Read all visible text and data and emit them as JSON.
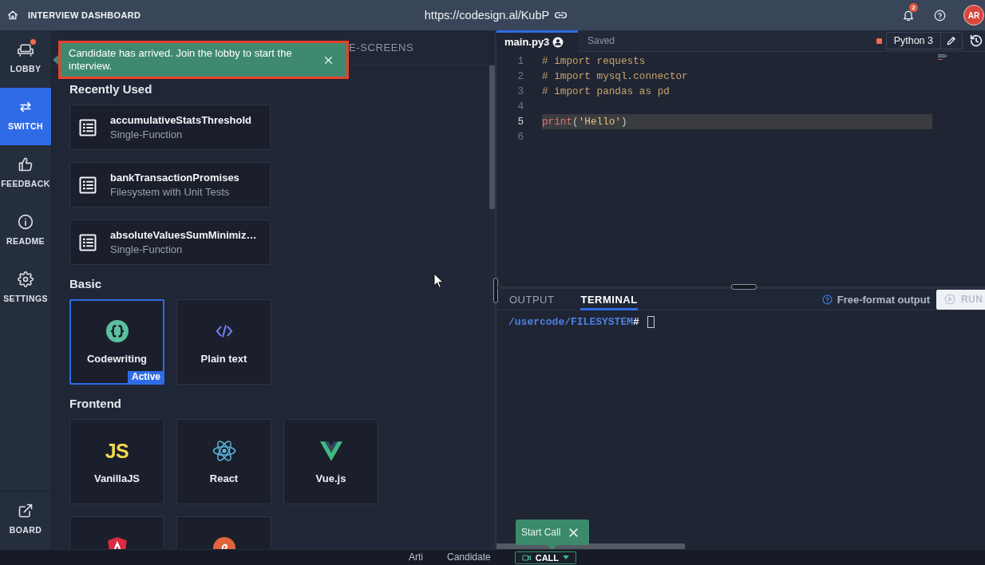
{
  "topbar": {
    "title": "INTERVIEW DASHBOARD",
    "url": "https://codesign.al/KubP",
    "notification_count": "2",
    "avatar_initials": "AR"
  },
  "sidebar": {
    "items": [
      {
        "kind": "lobby",
        "label": "LOBBY",
        "selected": false,
        "alert": true
      },
      {
        "kind": "switch",
        "label": "SWITCH",
        "selected": true,
        "alert": false
      },
      {
        "kind": "feedback",
        "label": "FEEDBACK",
        "selected": false,
        "alert": false
      },
      {
        "kind": "readme",
        "label": "README",
        "selected": false,
        "alert": false
      },
      {
        "kind": "settings",
        "label": "SETTINGS",
        "selected": false,
        "alert": false
      }
    ],
    "bottom_items": [
      {
        "kind": "board",
        "label": "BOARD",
        "selected": false,
        "alert": false
      }
    ]
  },
  "notification": {
    "message": "Candidate has arrived. Join the lobby to start the interview.",
    "highlighted": true
  },
  "switch_panel": {
    "tabs": [
      {
        "label": "E-SCREENS",
        "selected": false
      }
    ],
    "sections": [
      {
        "kind": "list",
        "title": "Recently Used",
        "items": [
          {
            "title": "accumulativeStatsThreshold",
            "subtitle": "Single-Function"
          },
          {
            "title": "bankTransactionPromises",
            "subtitle": "Filesystem with Unit Tests"
          },
          {
            "title": "absoluteValuesSumMinimiz…",
            "subtitle": "Single-Function"
          }
        ]
      },
      {
        "kind": "grid",
        "title": "Basic",
        "items": [
          {
            "kind": "codewriting",
            "label": "Codewriting",
            "selected": true,
            "badge": "Active"
          },
          {
            "kind": "plaintext",
            "label": "Plain text",
            "selected": false
          }
        ]
      },
      {
        "kind": "grid",
        "title": "Frontend",
        "items": [
          {
            "kind": "javascript",
            "logo_text": "JS",
            "label": "VanillaJS",
            "selected": false
          },
          {
            "kind": "react",
            "label": "React",
            "selected": false
          },
          {
            "kind": "vue",
            "label": "Vue.js",
            "selected": false
          },
          {
            "kind": "angular",
            "selected": false
          },
          {
            "kind": "ember",
            "selected": false
          }
        ]
      }
    ]
  },
  "editor": {
    "tabs": [
      {
        "label": "main.py3",
        "selected": true
      }
    ],
    "save_status": "Saved",
    "language": "Python 3",
    "lines": [
      {
        "number": "1",
        "current": false,
        "tokens": [
          {
            "kind": "comment",
            "text": "# import requests"
          }
        ]
      },
      {
        "number": "2",
        "current": false,
        "tokens": [
          {
            "kind": "comment",
            "text": "# import mysql.connector"
          }
        ]
      },
      {
        "number": "3",
        "current": false,
        "tokens": [
          {
            "kind": "comment",
            "text": "# import pandas as pd"
          }
        ]
      },
      {
        "number": "4",
        "current": false
      },
      {
        "number": "5",
        "current": true,
        "tokens": [
          {
            "kind": "function",
            "text": "print"
          },
          {
            "kind": "punct",
            "text": "("
          },
          {
            "kind": "string",
            "text": "'Hello'"
          },
          {
            "kind": "punct",
            "text": ")"
          }
        ]
      },
      {
        "number": "6",
        "current": false
      }
    ]
  },
  "output": {
    "tabs": [
      {
        "label": "OUTPUT",
        "selected": false
      },
      {
        "label": "TERMINAL",
        "selected": true
      }
    ],
    "mode_label": "Free-format output",
    "run_button": {
      "label": "RUN",
      "disabled": true
    },
    "terminal": {
      "path": "/usercode/FILESYSTEM",
      "prompt": "#"
    }
  },
  "call_tooltip": {
    "label": "Start Call"
  },
  "bottom_bar": {
    "participants": [
      "Arti",
      "Candidate"
    ],
    "call_button": "CALL"
  }
}
